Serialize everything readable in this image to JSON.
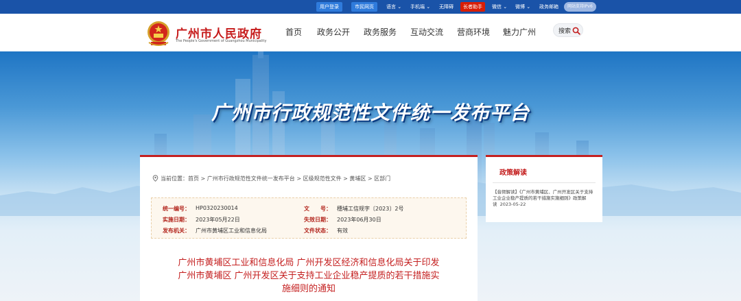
{
  "topbar": {
    "login": "用户登录",
    "citizen": "市民网页",
    "language": "语言",
    "mobile": "手机端",
    "accessible": "无障碍",
    "elder": "长者助手",
    "wechat": "微信",
    "weibo": "微博",
    "mail": "政务邮箱",
    "ipv6": "网站支持IPv6",
    "chevron": "⌄"
  },
  "header": {
    "logo_cn": "广州市人民政府",
    "logo_en": "The People's Government of Guangzhou Municipality",
    "nav": [
      "首页",
      "政务公开",
      "政务服务",
      "互动交流",
      "营商环境",
      "魅力广州"
    ],
    "search_label": "搜索"
  },
  "banner": {
    "title": "广州市行政规范性文件统一发布平台"
  },
  "breadcrumb": {
    "text": "当前位置：首页 > 广州市行政规范性文件统一发布平台 > 区级规范性文件 > 黄埔区 > 区部门"
  },
  "meta": {
    "code_label": "统一编号：",
    "code": "HP0320230014",
    "docno_label": "文　　号：",
    "docno": "穗埔工信规字〔2023〕2号",
    "impl_label": "实施日期：",
    "impl": "2023年05月22日",
    "expire_label": "失效日期：",
    "expire": "2023年06月30日",
    "issuer_label": "发布机关：",
    "issuer": "广州市黄埔区工业和信息化局",
    "status_label": "文件状态：",
    "status": "有效"
  },
  "doc": {
    "title_line1": "广州市黄埔区工业和信息化局 广州开发区经济和信息化局关于印发",
    "title_line2": "广州市黄埔区 广州开发区关于支持工业企业稳产提质的若干措施实",
    "title_line3": "施细则的通知"
  },
  "side": {
    "heading": "政策解读",
    "item": "【音频解读】《广州市黄埔区、广州开发区关于支持工业企业稳产提质的若干措施实施细则》政策解读",
    "item_date": "2023-05-22"
  }
}
